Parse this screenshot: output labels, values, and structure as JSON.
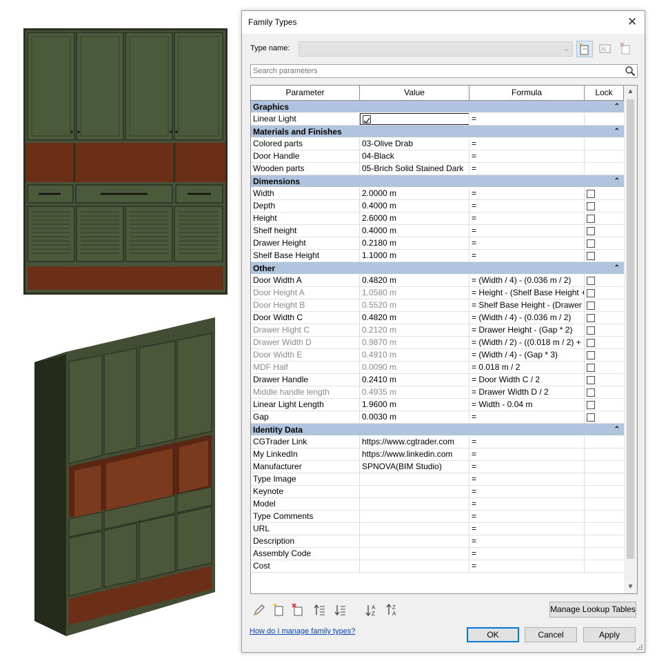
{
  "dialog": {
    "title": "Family Types",
    "close_glyph": "✕",
    "type_name_label": "Type name:",
    "type_name_value": "",
    "search_placeholder": "Search parameters",
    "columns": [
      "Parameter",
      "Value",
      "Formula",
      "Lock"
    ],
    "groups": [
      {
        "name": "Graphics",
        "rows": [
          {
            "param": "Linear Light",
            "value": "",
            "value_checkbox": true,
            "value_checked": true,
            "formula": "=",
            "lock": false,
            "readonly": false
          }
        ]
      },
      {
        "name": "Materials and Finishes",
        "rows": [
          {
            "param": "Colored parts",
            "value": "03-Olive Drab",
            "formula": "=",
            "lock": false,
            "readonly": false
          },
          {
            "param": "Door Handle",
            "value": "04-Black",
            "formula": "=",
            "lock": false,
            "readonly": false
          },
          {
            "param": "Wooden parts",
            "value": "05-Brich Solid Stained Dark",
            "formula": "=",
            "lock": false,
            "readonly": false
          }
        ]
      },
      {
        "name": "Dimensions",
        "rows": [
          {
            "param": "Width",
            "value": "2.0000 m",
            "formula": "=",
            "lock": true,
            "readonly": false
          },
          {
            "param": "Depth",
            "value": "0.4000 m",
            "formula": "=",
            "lock": true,
            "readonly": false
          },
          {
            "param": "Height",
            "value": "2.6000 m",
            "formula": "=",
            "lock": true,
            "readonly": false
          },
          {
            "param": "Shelf height",
            "value": "0.4000 m",
            "formula": "=",
            "lock": true,
            "readonly": false
          },
          {
            "param": "Drawer Height",
            "value": "0.2180 m",
            "formula": "=",
            "lock": true,
            "readonly": false
          },
          {
            "param": "Shelf Base Height",
            "value": "1.1000 m",
            "formula": "=",
            "lock": true,
            "readonly": false
          }
        ]
      },
      {
        "name": "Other",
        "rows": [
          {
            "param": "Door Width A",
            "value": "0.4820 m",
            "formula": "= (Width / 4) - (0.036 m / 2)",
            "lock": true,
            "readonly": false
          },
          {
            "param": "Door Height A",
            "value": "1.0580 m",
            "formula": "= Height - (Shelf Base Height +",
            "lock": true,
            "readonly": true
          },
          {
            "param": "Door Height B",
            "value": "0.5520 m",
            "formula": "= Shelf Base Height - (Drawer",
            "lock": true,
            "readonly": true
          },
          {
            "param": "Door Width C",
            "value": "0.4820 m",
            "formula": "= (Width / 4) - (0.036 m / 2)",
            "lock": true,
            "readonly": false
          },
          {
            "param": "Drawer Hight C",
            "value": "0.2120 m",
            "formula": "= Drawer Height - (Gap * 2)",
            "lock": true,
            "readonly": true
          },
          {
            "param": "Drawer Width D",
            "value": "0.9870 m",
            "formula": "= (Width / 2) - ((0.018 m / 2) +",
            "lock": true,
            "readonly": true
          },
          {
            "param": "Door Width E",
            "value": "0.4910 m",
            "formula": "= (Width / 4) - (Gap * 3)",
            "lock": true,
            "readonly": true
          },
          {
            "param": "MDF Half",
            "value": "0.0090 m",
            "formula": "= 0.018 m / 2",
            "lock": true,
            "readonly": true
          },
          {
            "param": "Drawer Handle",
            "value": "0.2410 m",
            "formula": "= Door Width C / 2",
            "lock": true,
            "readonly": false
          },
          {
            "param": "Middle handle length",
            "value": "0.4935 m",
            "formula": "= Drawer Width D / 2",
            "lock": true,
            "readonly": true
          },
          {
            "param": "Linear Light Length",
            "value": "1.9600 m",
            "formula": "= Width - 0.04 m",
            "lock": true,
            "readonly": false
          },
          {
            "param": "Gap",
            "value": "0.0030 m",
            "formula": "=",
            "lock": true,
            "readonly": false
          }
        ]
      },
      {
        "name": "Identity Data",
        "rows": [
          {
            "param": "CGTrader Link",
            "value": "https://www.cgtrader.com",
            "formula": "=",
            "lock": false,
            "readonly": false
          },
          {
            "param": "My LinkedIn",
            "value": "https://www.linkedin.com",
            "formula": "=",
            "lock": false,
            "readonly": false
          },
          {
            "param": "Manufacturer",
            "value": "SPNOVA(BIM Studio)",
            "formula": "=",
            "lock": false,
            "readonly": false
          },
          {
            "param": "Type Image",
            "value": "",
            "formula": "=",
            "lock": false,
            "readonly": false
          },
          {
            "param": "Keynote",
            "value": "",
            "formula": "=",
            "lock": false,
            "readonly": false
          },
          {
            "param": "Model",
            "value": "",
            "formula": "=",
            "lock": false,
            "readonly": false
          },
          {
            "param": "Type Comments",
            "value": "",
            "formula": "=",
            "lock": false,
            "readonly": false
          },
          {
            "param": "URL",
            "value": "",
            "formula": "=",
            "lock": false,
            "readonly": false
          },
          {
            "param": "Description",
            "value": "",
            "formula": "=",
            "lock": false,
            "readonly": false
          },
          {
            "param": "Assembly Code",
            "value": "",
            "formula": "=",
            "lock": false,
            "readonly": false
          },
          {
            "param": "Cost",
            "value": "",
            "formula": "=",
            "lock": false,
            "readonly": false
          }
        ]
      }
    ],
    "group_collapse_glyph": "⌃",
    "manage_lookup_label": "Manage Lookup Tables",
    "help_link": "How do I manage family types?",
    "ok_label": "OK",
    "cancel_label": "Cancel",
    "apply_label": "Apply",
    "toolbar_icons": [
      "pencil-icon",
      "new-parameter-icon",
      "delete-parameter-icon",
      "move-up-icon",
      "move-down-icon",
      "sort-ascending-icon",
      "sort-descending-icon"
    ]
  },
  "colors": {
    "group_header_bg": "#b0c4de",
    "cabinet_green": "#3f4a30",
    "wood_brown": "#6b2f18",
    "ok_border": "#0078d7",
    "link": "#0645ad"
  }
}
